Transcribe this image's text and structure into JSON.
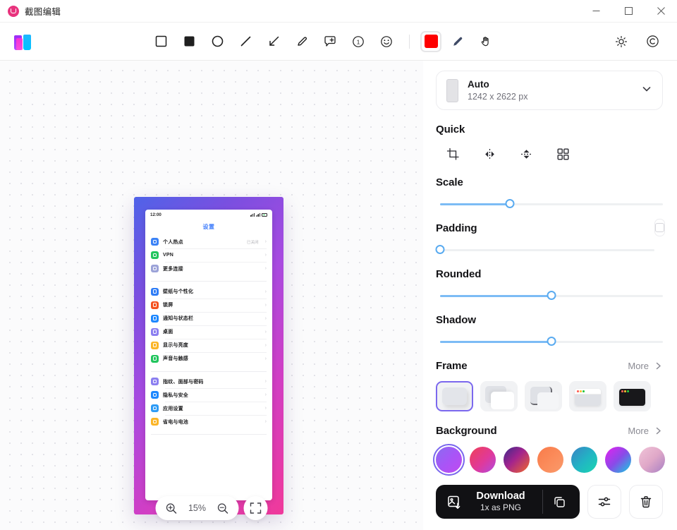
{
  "window": {
    "title": "截图编辑",
    "app_icon": "camera-icon",
    "controls": {
      "minimize": "minimize-icon",
      "maximize": "maximize-icon",
      "close": "close-icon"
    }
  },
  "toolbar": {
    "logo": "app-logo",
    "tools": [
      {
        "name": "rectangle-outline-tool",
        "glyph": "square"
      },
      {
        "name": "rectangle-filled-tool",
        "glyph": "square-filled"
      },
      {
        "name": "ellipse-tool",
        "glyph": "circle"
      },
      {
        "name": "line-tool",
        "glyph": "line"
      },
      {
        "name": "arrow-tool",
        "glyph": "arrow"
      },
      {
        "name": "pencil-tool",
        "glyph": "pencil"
      },
      {
        "name": "callout-tool",
        "glyph": "bubble-plus"
      },
      {
        "name": "step-number-tool",
        "glyph": "number-one"
      },
      {
        "name": "emoji-tool",
        "glyph": "smiley"
      }
    ],
    "color_swatch": {
      "name": "color-swatch",
      "color": "#fe0000"
    },
    "brush_tool": "brush-tool",
    "hand_tool": "hand-tool",
    "theme_toggle": "brightness-icon",
    "watermark_toggle": "copyright-icon"
  },
  "canvas": {
    "zoom": {
      "zoom_in": "zoom-in-icon",
      "level": "15%",
      "zoom_out": "zoom-out-icon",
      "fit": "fit-screen-icon"
    },
    "preview": {
      "frame_gradient": [
        "#4f63e8",
        "#7b4fe0",
        "#a84ae0",
        "#d13ec4",
        "#f0399a"
      ],
      "phone": {
        "status_time": "12:00",
        "page_title": "设置",
        "groups": [
          {
            "items": [
              {
                "label": "个人热点",
                "value": "已关闭",
                "color": "#3b82f6"
              },
              {
                "label": "VPN",
                "value": "",
                "color": "#22c55e"
              },
              {
                "label": "更多连接",
                "value": "",
                "color": "#9ca3d8"
              }
            ]
          },
          {
            "items": [
              {
                "label": "壁纸与个性化",
                "value": "",
                "color": "#2f7df6"
              },
              {
                "label": "锁屏",
                "value": "",
                "color": "#f4511e"
              },
              {
                "label": "通知与状态栏",
                "value": "",
                "color": "#1e88ff"
              },
              {
                "label": "桌面",
                "value": "",
                "color": "#8b7ff0"
              },
              {
                "label": "显示与亮度",
                "value": "",
                "color": "#fbb528"
              },
              {
                "label": "声音与触感",
                "value": "",
                "color": "#22c55e"
              }
            ]
          },
          {
            "items": [
              {
                "label": "指纹、面部与密码",
                "value": "",
                "color": "#8b7ff0"
              },
              {
                "label": "隐私与安全",
                "value": "",
                "color": "#1e88ff"
              },
              {
                "label": "应用设置",
                "value": "",
                "color": "#2f9cf6"
              },
              {
                "label": "省电与电池",
                "value": "",
                "color": "#fbb528"
              }
            ]
          }
        ]
      }
    }
  },
  "panel": {
    "size": {
      "label": "Auto",
      "dimensions": "1242 x 2622 px",
      "chevron": "chevron-down-icon"
    },
    "quick": {
      "title": "Quick",
      "actions": [
        {
          "name": "crop-icon"
        },
        {
          "name": "flip-horizontal-icon"
        },
        {
          "name": "flip-vertical-icon"
        },
        {
          "name": "grid-layout-icon"
        }
      ]
    },
    "sliders": [
      {
        "name": "scale",
        "label": "Scale",
        "percent": 32
      },
      {
        "name": "padding",
        "label": "Padding",
        "percent": 0
      },
      {
        "name": "rounded",
        "label": "Rounded",
        "percent": 51
      },
      {
        "name": "shadow",
        "label": "Shadow",
        "percent": 51
      }
    ],
    "frame": {
      "title": "Frame",
      "more": "More",
      "selected_index": 0,
      "options": [
        "shadow-frame",
        "stacked-frame",
        "edge-frame",
        "browser-light-frame",
        "browser-dark-frame"
      ]
    },
    "background": {
      "title": "Background",
      "more": "More",
      "selected_index": 0,
      "options": [
        {
          "name": "gradient-violet",
          "css": "linear-gradient(135deg,#8a6cf0 0%,#a855f7 50%,#c04af0 100%)"
        },
        {
          "name": "gradient-crimson-pink",
          "css": "linear-gradient(135deg,#ef4057 0%,#e0399a 55%,#b04ae0 100%)"
        },
        {
          "name": "gradient-purple-orange",
          "css": "linear-gradient(135deg,#3b2a8a 0%,#a3238e 45%,#f26a2a 100%)"
        },
        {
          "name": "gradient-orange",
          "css": "linear-gradient(135deg,#f97b4a 0%,#fb8b5a 50%,#fa9a6b 100%)"
        },
        {
          "name": "gradient-teal",
          "css": "linear-gradient(135deg,#3b82c4 0%,#22b3c4 50%,#19d6b0 100%)"
        },
        {
          "name": "gradient-magenta-cyan",
          "css": "linear-gradient(135deg,#e621f0 0%,#8a4ae8 50%,#0fd2e0 100%)"
        },
        {
          "name": "gradient-pink-blush",
          "css": "linear-gradient(135deg,#f0c4d8 0%,#e0a8c8 50%,#a87fc4 100%)"
        }
      ]
    },
    "download": {
      "icon": "image-download-icon",
      "title": "Download",
      "subtitle": "1x as PNG",
      "copy_icon": "copy-icon",
      "settings_icon": "sliders-icon",
      "delete_icon": "trash-icon"
    }
  }
}
